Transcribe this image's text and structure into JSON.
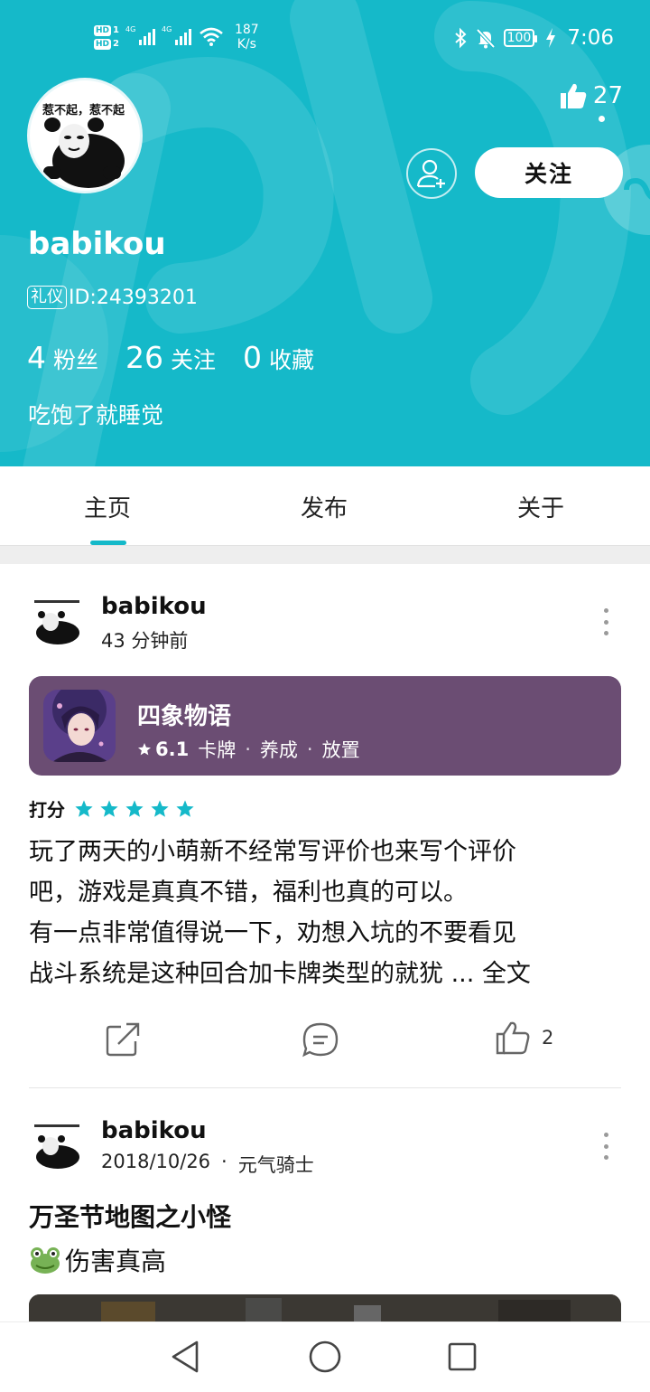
{
  "status_bar": {
    "sim1": "HD",
    "sim1_num": "1",
    "sim2": "HD",
    "sim2_num": "2",
    "net1": "4G",
    "net2": "4G",
    "speed_value": "187",
    "speed_unit": "K/s",
    "battery": "100",
    "time": "7:06"
  },
  "profile": {
    "avatar_caption": "惹不起，惹不起",
    "like_count": "27",
    "follow_label": "关注",
    "username": "babikou",
    "badge": "礼仪",
    "id_text": "ID:24393201",
    "stats": [
      {
        "num": "4",
        "label": "粉丝"
      },
      {
        "num": "26",
        "label": "关注"
      },
      {
        "num": "0",
        "label": "收藏"
      }
    ],
    "bio": "吃饱了就睡觉"
  },
  "tabs": [
    {
      "label": "主页",
      "active": true
    },
    {
      "label": "发布",
      "active": false
    },
    {
      "label": "关于",
      "active": false
    }
  ],
  "posts": [
    {
      "author": "babikou",
      "time": "43 分钟前",
      "game": {
        "title": "四象物语",
        "score": "6.1",
        "tags": [
          "卡牌",
          "养成",
          "放置"
        ],
        "card_color": "#6b4d73"
      },
      "rating_label": "打分",
      "rating": 5,
      "text_lines": [
        "玩了两天的小萌新不经常写评价也来写个评价",
        "吧，游戏是真真不错，福利也真的可以。",
        "有一点非常值得说一下，劝想入坑的不要看见",
        "战斗系统是这种回合加卡牌类型的就犹 ..."
      ],
      "full_text_link": "全文",
      "like_count": "2"
    },
    {
      "author": "babikou",
      "date": "2018/10/26",
      "sep": "·",
      "game_name": "元气骑士",
      "title": "万圣节地图之小怪",
      "body": "伤害真高"
    }
  ],
  "colors": {
    "accent": "#15b9c9",
    "card": "#6b4d73",
    "star": "#15b9c9"
  }
}
